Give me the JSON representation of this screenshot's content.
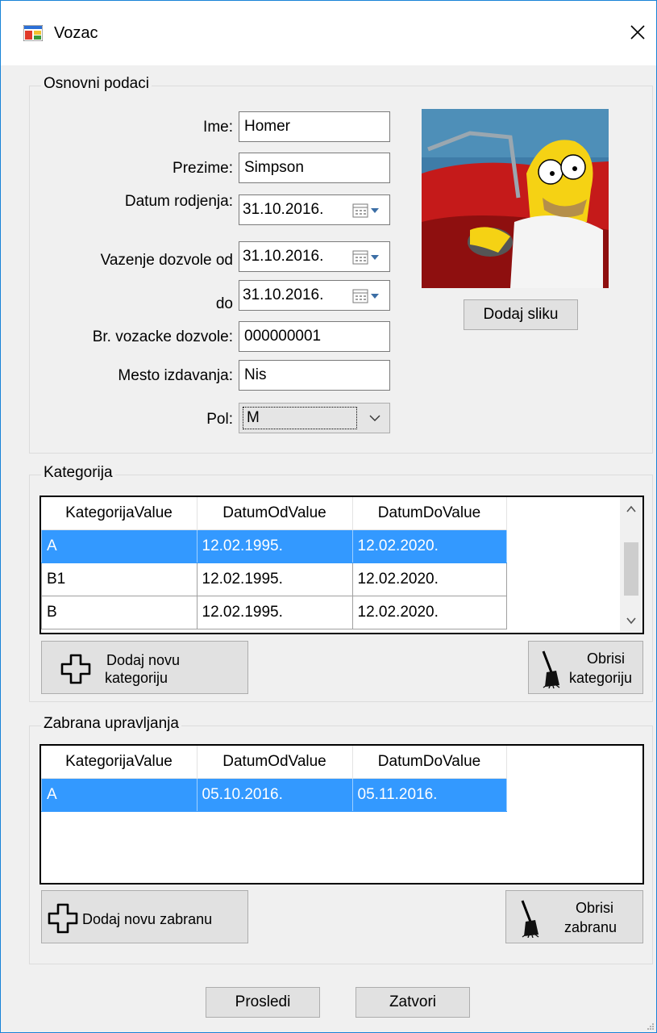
{
  "window": {
    "title": "Vozac"
  },
  "osnovni": {
    "group_title": "Osnovni podaci",
    "ime_label": "Ime:",
    "ime_value": "Homer",
    "prezime_label": "Prezime:",
    "prezime_value": "Simpson",
    "datum_rodjenja_label": "Datum rodjenja:",
    "datum_rodjenja_value": "31.10.2016.",
    "vazenje_od_label": "Vazenje dozvole od",
    "vazenje_od_value": "31.10.2016.",
    "vazenje_do_label": "do",
    "vazenje_do_value": "31.10.2016.",
    "br_dozvole_label": "Br. vozacke dozvole:",
    "br_dozvole_value": "000000001",
    "mesto_label": "Mesto izdavanja:",
    "mesto_value": "Nis",
    "pol_label": "Pol:",
    "pol_value": "M",
    "dodaj_sliku": "Dodaj sliku"
  },
  "kategorija": {
    "group_title": "Kategorija",
    "columns": [
      "KategorijaValue",
      "DatumOdValue",
      "DatumDoValue"
    ],
    "rows": [
      [
        "A",
        "12.02.1995.",
        "12.02.2020."
      ],
      [
        "B1",
        "12.02.1995.",
        "12.02.2020."
      ],
      [
        "B",
        "12.02.1995.",
        "12.02.2020."
      ]
    ],
    "add_button_line1": "Dodaj novu",
    "add_button_line2": "kategoriju",
    "delete_button_line1": "Obrisi",
    "delete_button_line2": "kategoriju"
  },
  "zabrana": {
    "group_title": "Zabrana upravljanja",
    "columns": [
      "KategorijaValue",
      "DatumOdValue",
      "DatumDoValue"
    ],
    "rows": [
      [
        "A",
        "05.10.2016.",
        "05.11.2016."
      ]
    ],
    "add_button": "Dodaj novu zabranu",
    "delete_button_line1": "Obrisi",
    "delete_button_line2": "zabranu"
  },
  "footer": {
    "prosledi": "Prosledi",
    "zatvori": "Zatvori"
  },
  "colors": {
    "selection": "#3399ff",
    "window_border": "#1883d7"
  },
  "icons": [
    "app-form-icon",
    "close-icon",
    "calendar-icon",
    "chevron-down-icon",
    "plus-icon",
    "broom-icon"
  ]
}
